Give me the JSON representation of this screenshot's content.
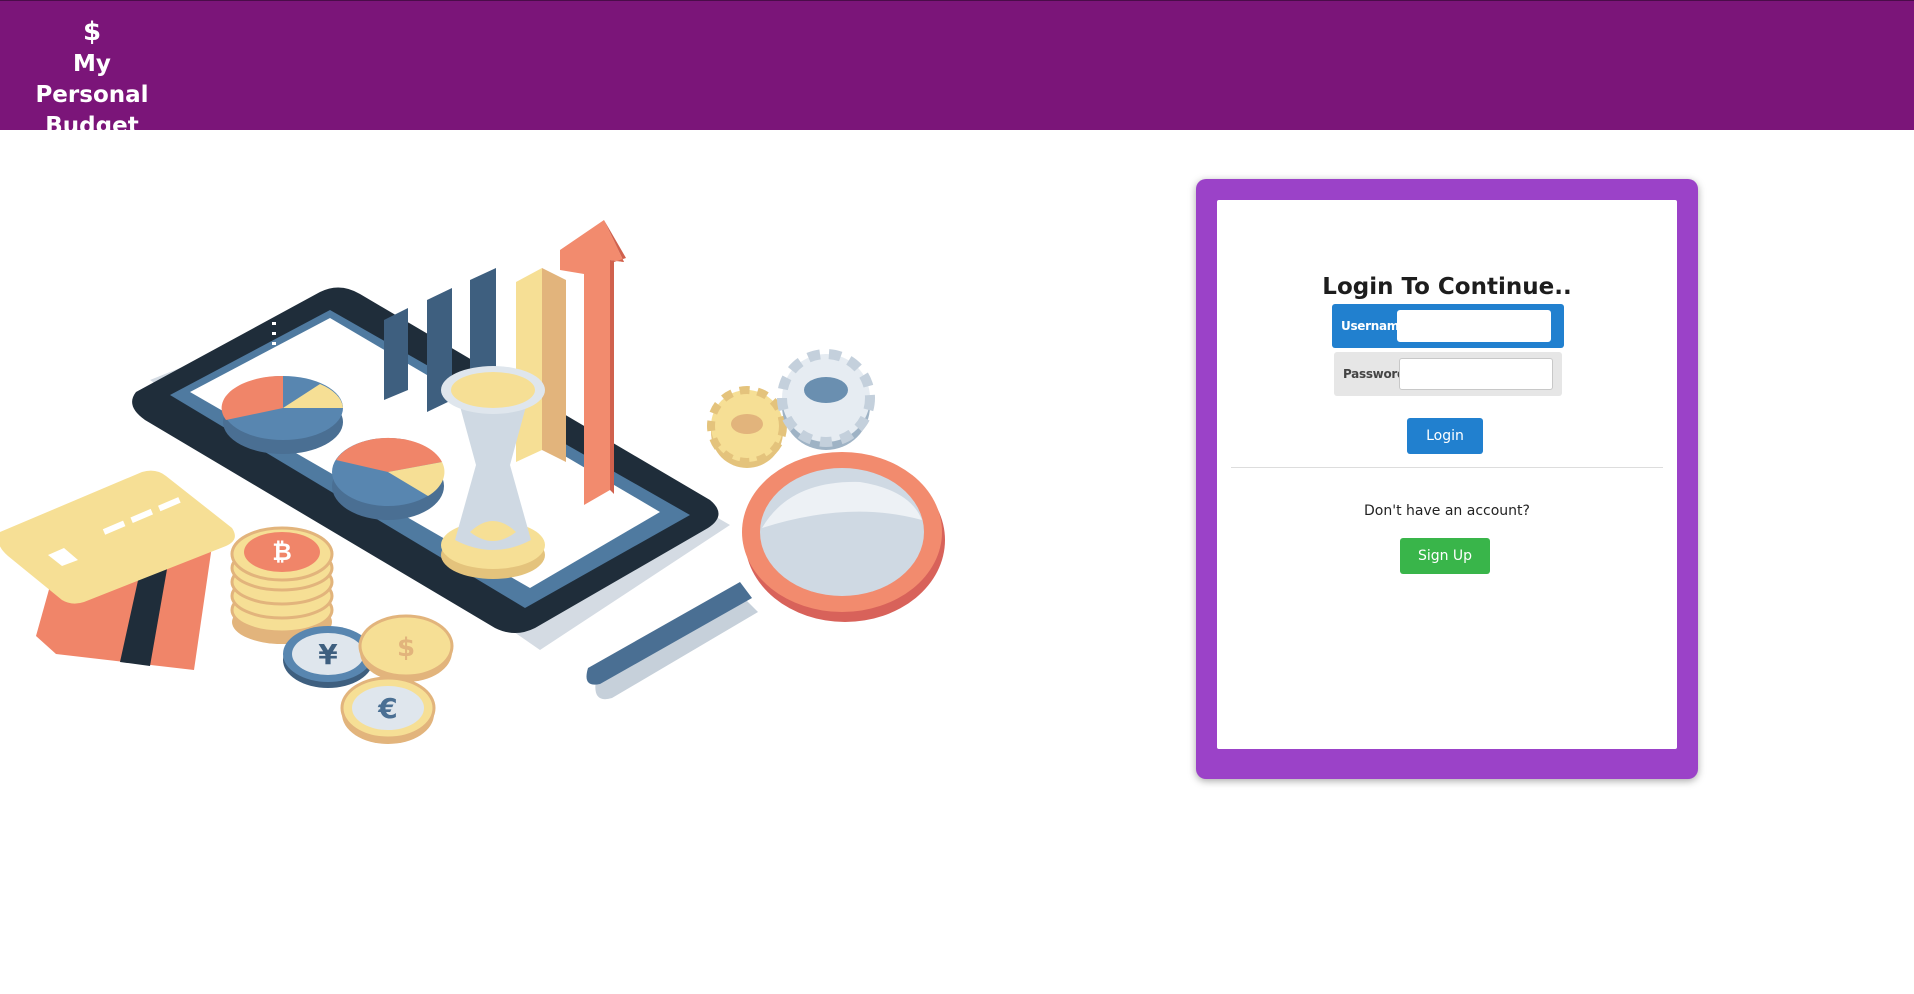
{
  "header": {
    "icon": "dollar-icon",
    "icon_glyph": "$",
    "title": "My Personal Budget",
    "background": "#7b1579"
  },
  "illustration": {
    "subject": "finance-illustration",
    "coin_symbols": [
      "₿",
      "¥",
      "$",
      "€"
    ]
  },
  "login": {
    "title": "Login To Continue..",
    "username_label": "Username:",
    "username_value": "",
    "password_label": "Password:",
    "password_value": "",
    "login_button": "Login",
    "signup_prompt": "Don't have an account?",
    "signup_button": "Sign Up",
    "frame_color": "#9b42c8",
    "primary_color": "#2180cf",
    "success_color": "#39b54a"
  }
}
